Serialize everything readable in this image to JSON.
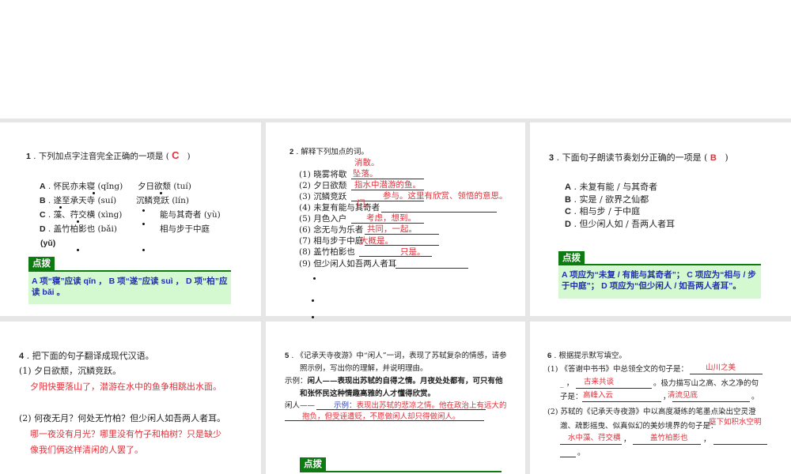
{
  "q1": {
    "num": "1",
    "stem": "下列加点字注音完全正确的一项是 (",
    "answer": "C",
    "close": ")",
    "options": [
      {
        "letter": "A",
        "left": "怀民亦未寝 (qǐng)",
        "right": "夕日欲颓 (tuí)"
      },
      {
        "letter": "B",
        "left": "遂至承天寺 (suí)",
        "right": "沉鳞竞跃 (lín)"
      },
      {
        "letter": "C",
        "left": "藻、荇交横 (xìng)",
        "right": "能与其奇者 (yù)"
      },
      {
        "letter": "D",
        "left": "盖竹柏影也 (bǎi)",
        "right": "相与步于中庭"
      }
    ],
    "extra": "(yǔ)",
    "tip_label": "点拨",
    "tip": "A 项“寝”应读 qǐn ， B 项“遂”应读 suì ， D 项“柏”应读 bǎi 。"
  },
  "q2": {
    "num": "2",
    "stem": "解释下列加点的词。",
    "items": [
      {
        "label": "(1) 晓雾将歇",
        "answer": "消散。"
      },
      {
        "label": "(2) 夕日欲颓",
        "answer": "坠落。"
      },
      {
        "label": "(3) 沉鳞竞跃",
        "answer": "指水中潜游的鱼。"
      },
      {
        "label": "(4) 未复有能与其奇者",
        "answer": "参与。这里有欣赏、领悟的意思。"
      },
      {
        "label": "(5) 月色入户",
        "answer": "门。"
      },
      {
        "label": "(6) 念无与为乐者",
        "answer": "考虑，想到。"
      },
      {
        "label": "(7) 相与步于中庭",
        "answer": "共同，一起。"
      },
      {
        "label": "(8) 盖竹柏影也",
        "answer": "大概是。"
      },
      {
        "label": "(9) 但少闲人如吾两人者耳",
        "answer": "只是。"
      }
    ]
  },
  "q3": {
    "num": "3",
    "stem": "下面句子朗读节奏划分正确的一项是 (",
    "answer": "B",
    "close": ")",
    "options": [
      {
        "letter": "A",
        "text": "未复有能 / 与其奇者"
      },
      {
        "letter": "B",
        "text": "实是 / 欲界之仙都"
      },
      {
        "letter": "C",
        "text": "相与步 / 于中庭"
      },
      {
        "letter": "D",
        "text": "但少闲人如 / 吾两人者耳"
      }
    ],
    "tip_label": "点拨",
    "tip": "A 项应为“未复 / 有能与其奇者”； C 项应为“相与 / 步于中庭”； D 项应为“但少闲人 / 如吾两人者耳”。"
  },
  "q4": {
    "num": "4",
    "stem": "把下面的句子翻译成现代汉语。",
    "s1": "(1) 夕日欲颓，沉鳞竞跃。",
    "a1": "夕阳快要落山了，潜游在水中的鱼争相跳出水面。",
    "s2": "(2) 何夜无月？何处无竹柏？但少闲人如吾两人者耳。",
    "a2a": "哪一夜没有月光？哪里没有竹子和柏树？只是缺少",
    "a2b": "像我们俩这样清闲的人罢了。"
  },
  "q5": {
    "num": "5",
    "stem1": "《记承天寺夜游》中“闲人”一词，表现了苏轼复杂的情感，请参",
    "stem2": "照示例，写出你的理解，并说明理由。",
    "ex_label": "示例：",
    "ex1": "闲人——表现出苏轼的自得之情。月夜处处都有，可只有他",
    "ex2": "和张怀民这种情趣高雅的人才懂得欣赏。",
    "blank_label": "闲人——",
    "ans_prefix": "示例：",
    "ans1": "表现出苏轼的悲凉之情。他在政治上有远大的",
    "ans2": "抱负，但受诬遭贬，不愿做闲人却只得做闲人。",
    "tip_label": "点拨"
  },
  "q6": {
    "num": "6",
    "stem": "根据提示默写填空。",
    "p1a": "(1) 《答谢中书书》中总领全文的句子是：",
    "a1": "山川之美",
    "p1b": "_ ，",
    "a2": "古来共谈",
    "p1c": "。极力描写山之高、水之净的句",
    "p1d": "子是：",
    "a3": "高峰入云",
    "comma": "，",
    "a4": "清流见底",
    "period": "。",
    "p2a": "(2)  苏轼的《记承天寺夜游》中以高度凝练的笔墨点染出空灵澄",
    "p2b": "澈、疏影摇曳、似真似幻的美妙境界的句子是：",
    "a5": "庭下如积水空明",
    "a6": "水中藻、荇交横",
    "a7": "盖竹柏影也",
    "end": "。"
  }
}
